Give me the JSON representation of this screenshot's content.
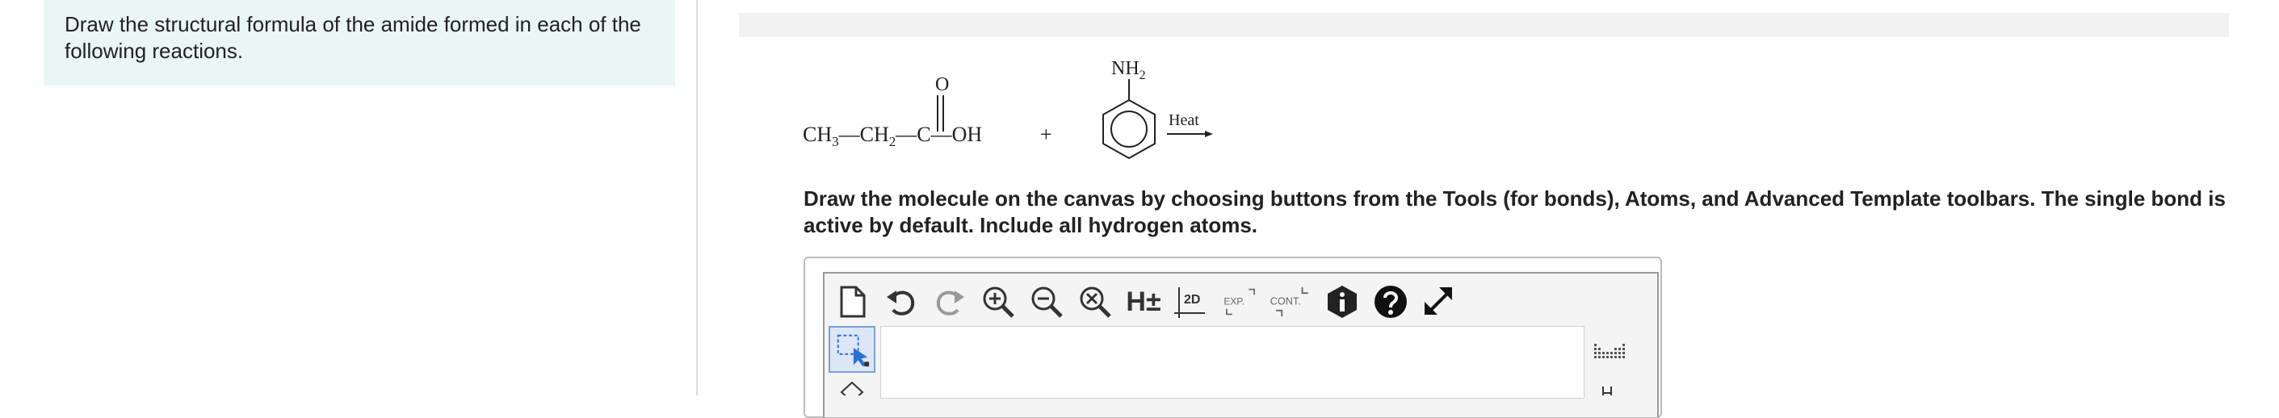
{
  "question": {
    "prompt": "Draw the structural formula of the amide formed in each of the following reactions."
  },
  "reaction": {
    "reactant1_prefix": "CH",
    "reactant1_sub1": "3",
    "reactant1_mid": "—CH",
    "reactant1_sub2": "2",
    "reactant1_carbon": "—C—OH",
    "carbonyl_oxygen": "O",
    "plus": "+",
    "amine_group": "NH",
    "amine_sub": "2",
    "condition": "Heat"
  },
  "instructions": {
    "text": "Draw the molecule on the canvas by choosing buttons from the Tools (for bonds), Atoms, and Advanced Template toolbars. The single bond is active by default. Include all hydrogen atoms."
  },
  "toolbar": {
    "h_label": "H±",
    "twod_label": "2D",
    "exp_label": "EXP.",
    "cont_label": "CONT."
  }
}
